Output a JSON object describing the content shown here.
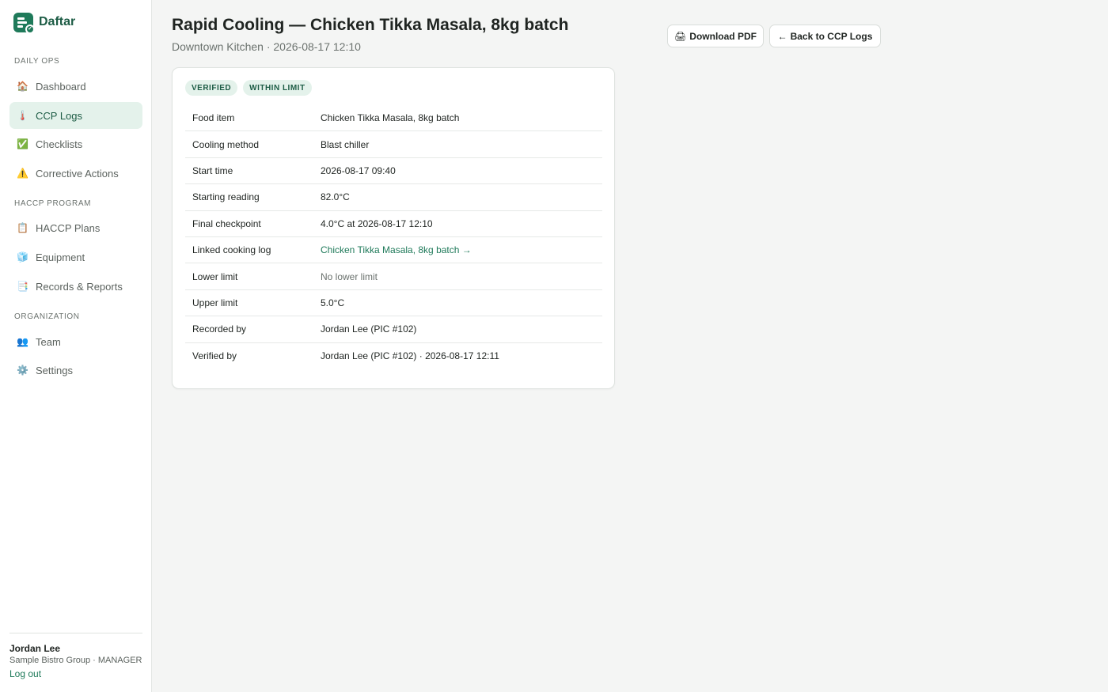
{
  "brand": {
    "name": "Daftar",
    "accent": "#1f7a5a"
  },
  "sidebar": {
    "sections": [
      {
        "label": "DAILY OPS"
      },
      {
        "label": "HACCP PROGRAM"
      },
      {
        "label": "ORGANIZATION"
      }
    ],
    "items": [
      {
        "label": "Dashboard",
        "icon": "house-icon",
        "glyph": "🏠"
      },
      {
        "label": "CCP Logs",
        "icon": "thermometer-icon",
        "glyph": "🌡️",
        "active": true
      },
      {
        "label": "Checklists",
        "icon": "checkmark-icon",
        "glyph": "✅"
      },
      {
        "label": "Corrective Actions",
        "icon": "warning-icon",
        "glyph": "⚠️"
      },
      {
        "label": "HACCP Plans",
        "icon": "clipboard-icon",
        "glyph": "📋"
      },
      {
        "label": "Equipment",
        "icon": "ice-cube-icon",
        "glyph": "🧊"
      },
      {
        "label": "Records & Reports",
        "icon": "document-icon",
        "glyph": "📑"
      },
      {
        "label": "Team",
        "icon": "people-icon",
        "glyph": "👥"
      },
      {
        "label": "Settings",
        "icon": "gear-icon",
        "glyph": "⚙️"
      }
    ],
    "user": {
      "name": "Jordan Lee",
      "org": "Sample Bistro Group · MANAGER",
      "logout": "Log out"
    }
  },
  "header": {
    "title": "Rapid Cooling — Chicken Tikka Masala, 8kg batch",
    "subtitle": "Downtown Kitchen · 2026-08-17 12:10",
    "download_label": "Download PDF",
    "download_glyph": "🖨",
    "back_label": "Back to CCP Logs",
    "back_glyph": "←"
  },
  "record": {
    "badges": [
      "VERIFIED",
      "WITHIN LIMIT"
    ],
    "rows": [
      {
        "label": "Food item",
        "value": "Chicken Tikka Masala, 8kg batch"
      },
      {
        "label": "Cooling method",
        "value": "Blast chiller"
      },
      {
        "label": "Start time",
        "value": "2026-08-17 09:40"
      },
      {
        "label": "Starting reading",
        "value": "82.0°C"
      },
      {
        "label": "Final checkpoint",
        "value": "4.0°C at 2026-08-17 12:10"
      },
      {
        "label": "Linked cooking log",
        "value": "Chicken Tikka Masala, 8kg batch →"
      },
      {
        "label": "Lower limit",
        "value": "No lower limit"
      },
      {
        "label": "Upper limit",
        "value": "5.0°C"
      },
      {
        "label": "Recorded by",
        "value": "Jordan Lee (PIC #102)"
      },
      {
        "label": "Verified by",
        "value": "Jordan Lee (PIC #102) · 2026-08-17 12:11"
      }
    ]
  }
}
